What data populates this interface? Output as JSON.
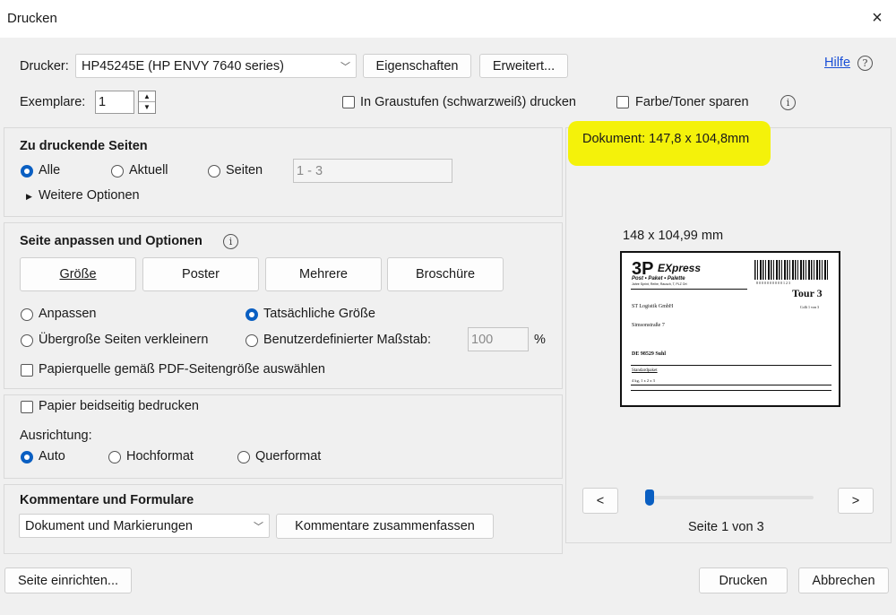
{
  "window": {
    "title": "Drucken",
    "close_icon": "×"
  },
  "printer": {
    "label": "Drucker:",
    "selected": "HP45245E (HP ENVY 7640 series)",
    "properties_button": "Eigenschaften",
    "advanced_button": "Erweitert...",
    "help_link": "Hilfe",
    "help_icon": "?"
  },
  "copies": {
    "label": "Exemplare:",
    "value": "1",
    "grayscale_label": "In Graustufen (schwarzweiß) drucken",
    "save_toner_label": "Farbe/Toner sparen",
    "info_icon": "i"
  },
  "pages": {
    "heading": "Zu druckende Seiten",
    "all_label": "Alle",
    "current_label": "Aktuell",
    "pages_label": "Seiten",
    "pages_range_placeholder": "1 - 3",
    "more_options_label": "Weitere Optionen"
  },
  "fit": {
    "heading": "Seite anpassen und Optionen",
    "info_icon": "i",
    "tabs": [
      "Größe",
      "Poster",
      "Mehrere",
      "Broschüre"
    ],
    "fit_label": "Anpassen",
    "actual_size_label": "Tatsächliche Größe",
    "shrink_label": "Übergroße Seiten verkleinern",
    "custom_scale_label": "Benutzerdefinierter Maßstab:",
    "custom_scale_value": "100",
    "percent": "%",
    "pdf_paper_source_label": "Papierquelle gemäß PDF-Seitengröße auswählen"
  },
  "duplex": {
    "both_sides_label": "Papier beidseitig bedrucken",
    "orientation_label": "Ausrichtung:",
    "auto_label": "Auto",
    "portrait_label": "Hochformat",
    "landscape_label": "Querformat"
  },
  "comments": {
    "heading": "Kommentare und Formulare",
    "selected": "Dokument und Markierungen",
    "summarize_button": "Kommentare zusammenfassen"
  },
  "preview": {
    "document_size": "Dokument: 147,8 x 104,8mm",
    "page_size": "148 x 104,99 mm",
    "prev_button": "<",
    "next_button": ">",
    "page_indicator": "Seite 1 von 3",
    "slider_position": 0,
    "highlight_color": "#f4f20a",
    "label": {
      "logo_main": "3P",
      "logo_express": "EXpress",
      "logo_sub": "Post • Paket • Palette",
      "logo_small": "Jahre Sprint, Reihe, Rausch, T, PLZ Ort",
      "barcode_digits": "8 0 0 0 0 0 0 0 0 0 1 2 3",
      "tour": "Tour 3",
      "sender": "ST Logistik GmbH",
      "page_count": "Colli 1 von 3",
      "street": "Simsonstraße 7",
      "city": "DE 98529 Suhl",
      "service": "Standardpaket",
      "weight": "4 kg, 1 x 2 x 3"
    }
  },
  "footer": {
    "page_setup_button": "Seite einrichten...",
    "print_button": "Drucken",
    "cancel_button": "Abbrechen"
  }
}
